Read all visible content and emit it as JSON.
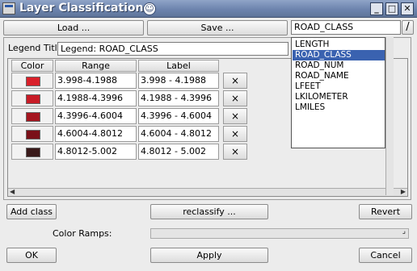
{
  "window": {
    "title": "Layer Classification",
    "controls": {
      "minimize": "_",
      "maximize": "□",
      "close": "✕"
    }
  },
  "toolbar": {
    "load_label": "Load ...",
    "save_label": "Save ...",
    "field_select_value": "ROAD_CLASS"
  },
  "legend": {
    "title_label": "Legend Title:",
    "title_value": "Legend: ROAD_CLASS"
  },
  "field_dropdown": {
    "options": [
      "LENGTH",
      "ROAD_CLASS",
      "ROAD_NUM",
      "ROAD_NAME",
      "LFEET",
      "LKILOMETER",
      "LMILES"
    ],
    "selected": "ROAD_CLASS"
  },
  "table": {
    "headers": {
      "color": "Color",
      "range": "Range",
      "label": "Label"
    },
    "rows": [
      {
        "color": "#d9202a",
        "range": "3.998-4.1988",
        "label": "3.998 - 4.1988",
        "delete": "×"
      },
      {
        "color": "#c81c27",
        "range": "4.1988-4.3996",
        "label": "4.1988 - 4.3996",
        "delete": "×"
      },
      {
        "color": "#a5151f",
        "range": "4.3996-4.6004",
        "label": "4.3996 - 4.6004",
        "delete": "×"
      },
      {
        "color": "#7a1018",
        "range": "4.6004-4.8012",
        "label": "4.6004 - 4.8012",
        "delete": "×"
      },
      {
        "color": "#3a1a1a",
        "range": "4.8012-5.002",
        "label": "4.8012 - 5.002",
        "delete": "×"
      }
    ]
  },
  "actions": {
    "add_class": "Add class",
    "reclassify": "reclassify ...",
    "revert": "Revert"
  },
  "ramps": {
    "label": "Color Ramps:"
  },
  "footer": {
    "ok": "OK",
    "apply": "Apply",
    "cancel": "Cancel"
  }
}
